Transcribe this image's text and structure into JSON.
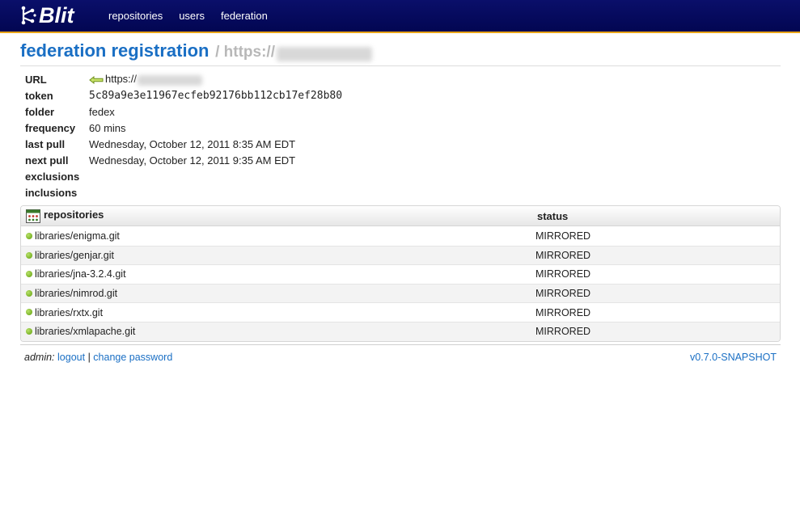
{
  "app": {
    "name": "Blit"
  },
  "nav": {
    "items": [
      "repositories",
      "users",
      "federation"
    ]
  },
  "page": {
    "title": "federation registration",
    "subtitle_prefix": "/ https://"
  },
  "properties": [
    {
      "label": "URL",
      "value": "https://"
    },
    {
      "label": "token",
      "value": "5c89a9e3e11967ecfeb92176bb112cb17ef28b80"
    },
    {
      "label": "folder",
      "value": "fedex"
    },
    {
      "label": "frequency",
      "value": "60 mins"
    },
    {
      "label": "last pull",
      "value": "Wednesday, October 12, 2011 8:35 AM EDT"
    },
    {
      "label": "next pull",
      "value": "Wednesday, October 12, 2011 9:35 AM EDT"
    },
    {
      "label": "exclusions",
      "value": ""
    },
    {
      "label": "inclusions",
      "value": ""
    }
  ],
  "repositories": {
    "columns": {
      "name": "repositories",
      "status": "status"
    },
    "rows": [
      {
        "name": "libraries/enigma.git",
        "status": "MIRRORED"
      },
      {
        "name": "libraries/genjar.git",
        "status": "MIRRORED"
      },
      {
        "name": "libraries/jna-3.2.4.git",
        "status": "MIRRORED"
      },
      {
        "name": "libraries/nimrod.git",
        "status": "MIRRORED"
      },
      {
        "name": "libraries/rxtx.git",
        "status": "MIRRORED"
      },
      {
        "name": "libraries/xmlapache.git",
        "status": "MIRRORED"
      }
    ]
  },
  "footer": {
    "user": "admin:",
    "logout": "logout",
    "separator": "|",
    "change_password": "change password",
    "version": "v0.7.0-SNAPSHOT"
  },
  "colors": {
    "nav_bg": "#020652",
    "nav_border": "#e8a317",
    "link": "#1a6fc4",
    "status_dot": "#5f9e0a"
  },
  "icons": {
    "logo": "git-branch-logo-icon",
    "url_arrow": "arrow-left-icon",
    "repositories_header": "table-grid-icon",
    "repo_status": "green-dot-icon"
  }
}
